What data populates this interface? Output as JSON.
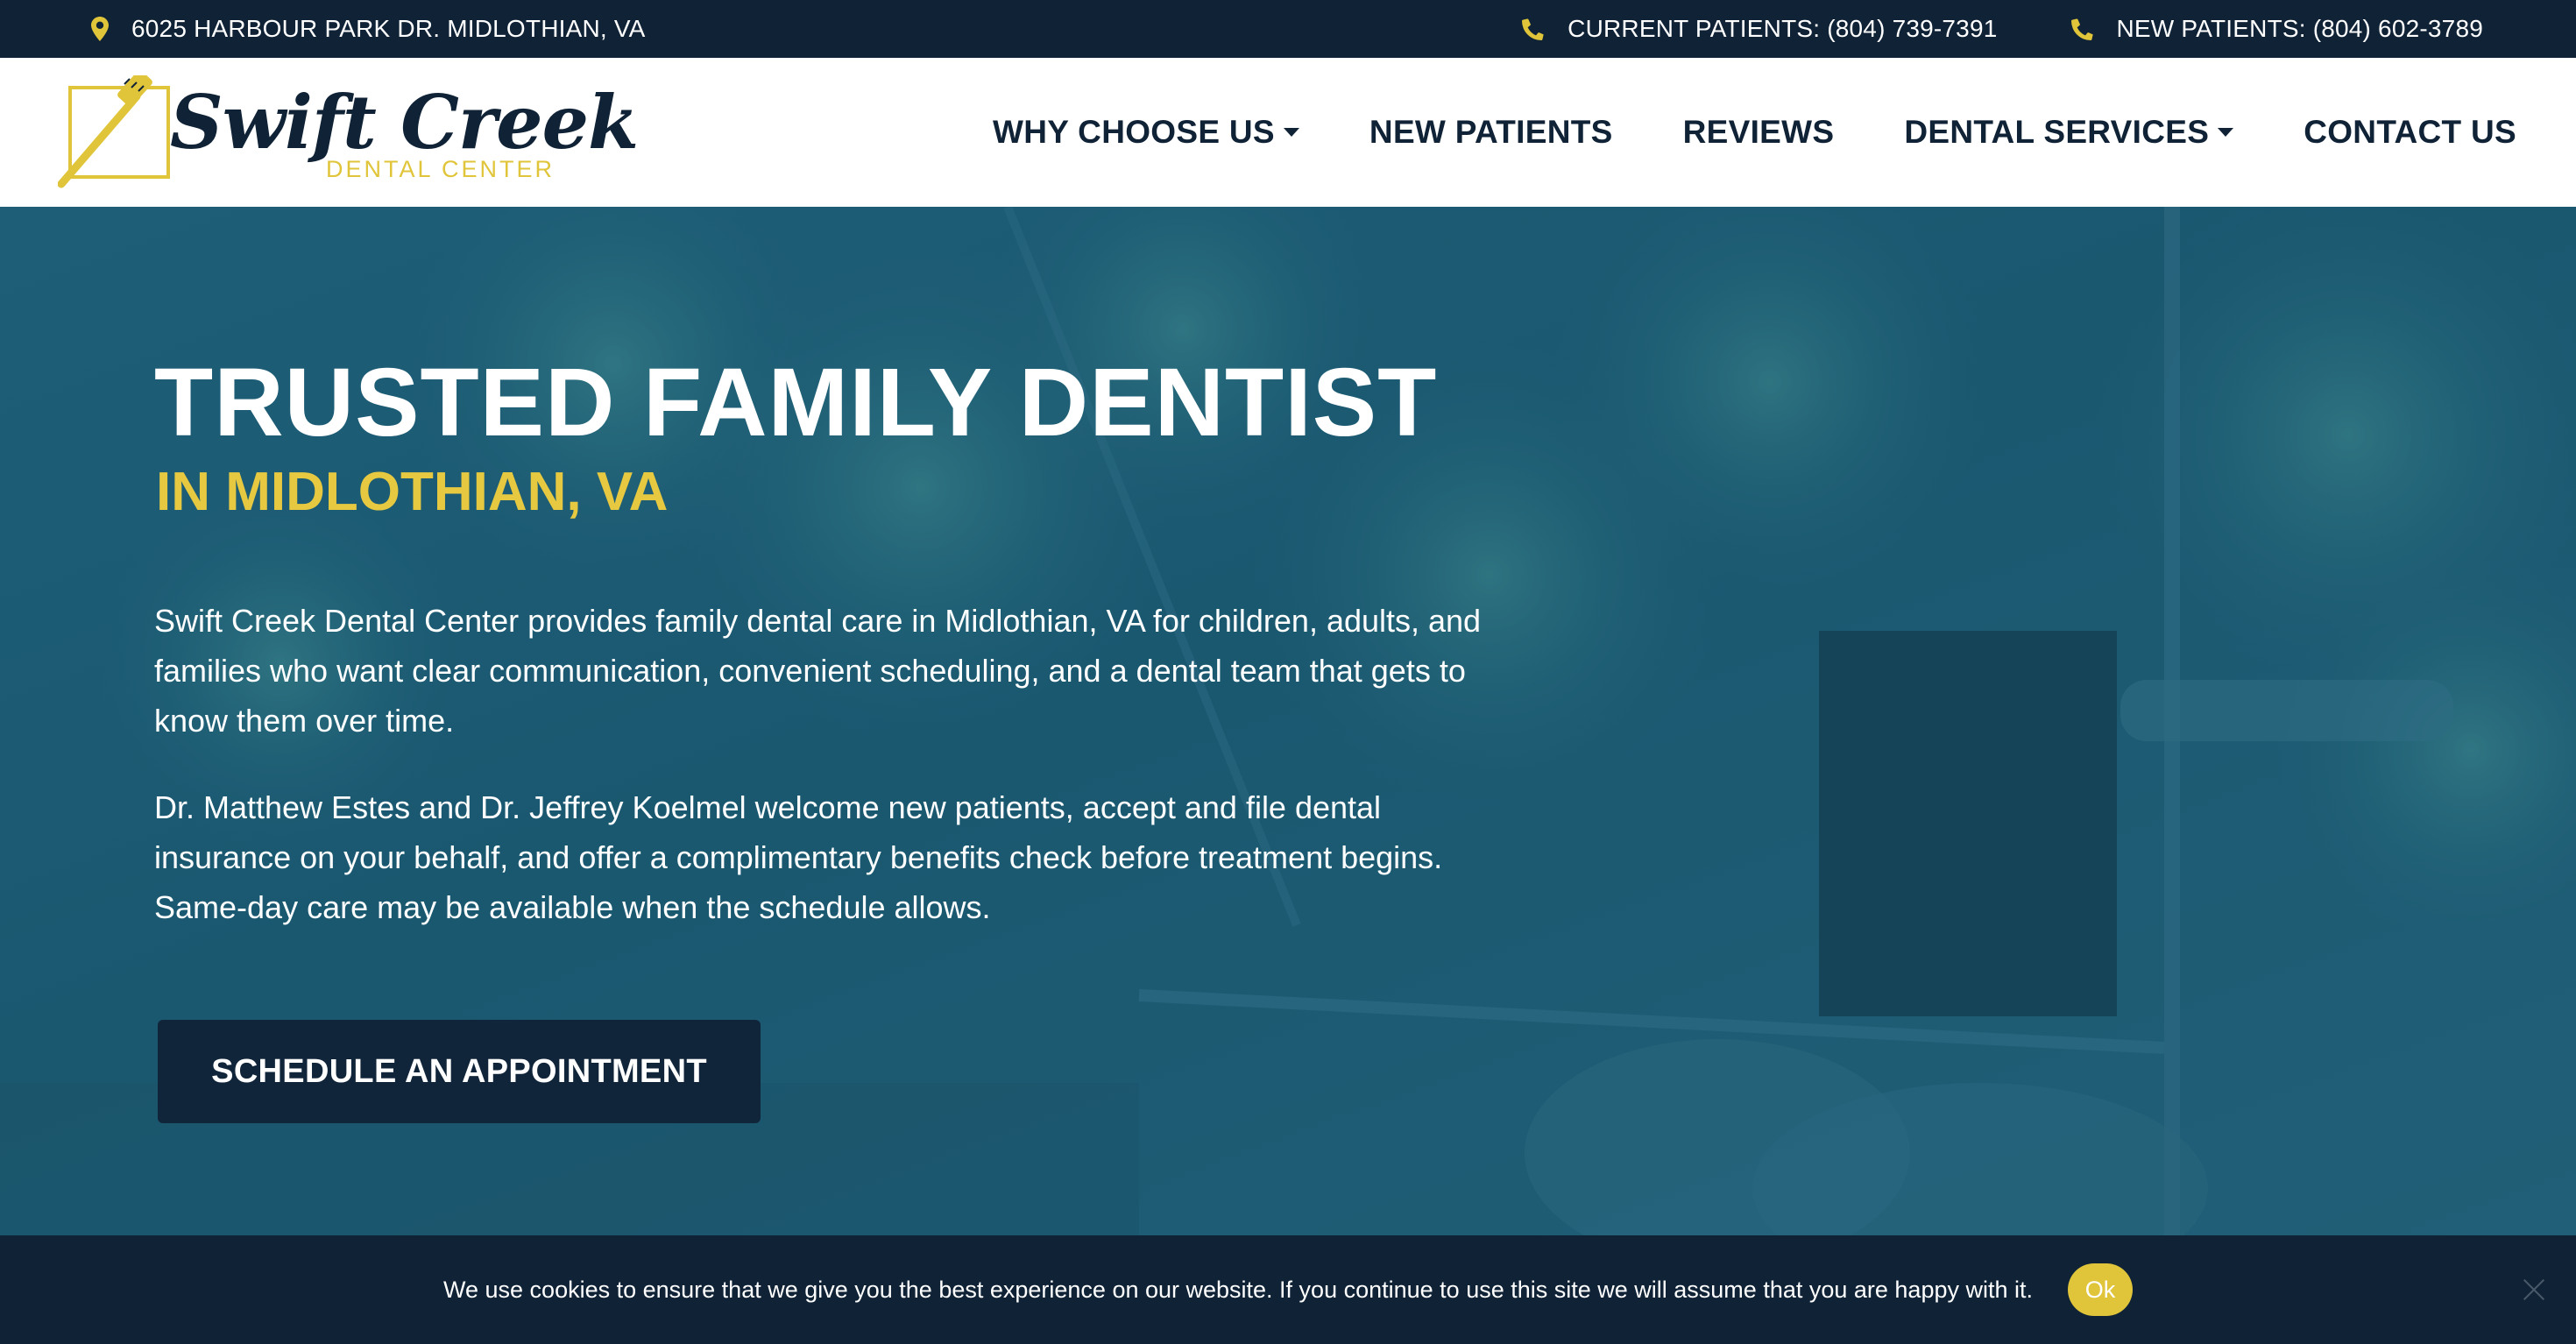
{
  "topbar": {
    "address": "6025 HARBOUR PARK DR. MIDLOTHIAN, VA",
    "current_patients": "CURRENT PATIENTS: (804) 739-7391",
    "new_patients": "NEW PATIENTS: (804) 602-3789"
  },
  "logo": {
    "name": "Swift Creek",
    "sub": "DENTAL CENTER"
  },
  "nav": {
    "items": [
      {
        "label": "WHY CHOOSE US",
        "dropdown": true
      },
      {
        "label": "NEW PATIENTS",
        "dropdown": false
      },
      {
        "label": "REVIEWS",
        "dropdown": false
      },
      {
        "label": "DENTAL SERVICES",
        "dropdown": true
      },
      {
        "label": "CONTACT US",
        "dropdown": false
      }
    ]
  },
  "hero": {
    "title": "TRUSTED FAMILY DENTIST",
    "subtitle": "IN MIDLOTHIAN, VA",
    "paragraph1": "Swift Creek Dental Center provides family dental care in Midlothian, VA for children, adults, and families who want clear communication, convenient scheduling, and a dental team that gets to know them over time.",
    "paragraph2": "Dr. Matthew Estes and Dr. Jeffrey Koelmel welcome new patients, accept and file dental insurance on your behalf, and offer a complimentary benefits check before treatment begins. Same-day care may be available when the schedule allows.",
    "cta_label": "SCHEDULE AN APPOINTMENT"
  },
  "cookie": {
    "message": "We use cookies to ensure that we give you the best experience on our website. If you continue to use this site we will assume that you are happy with it.",
    "ok_label": "Ok"
  },
  "colors": {
    "navy": "#0f2236",
    "gold": "#e0c53a",
    "hero_overlay": "#1c5a73"
  },
  "icons": [
    "map-pin-icon",
    "phone-icon",
    "toothbrush-logo-icon",
    "close-icon"
  ]
}
